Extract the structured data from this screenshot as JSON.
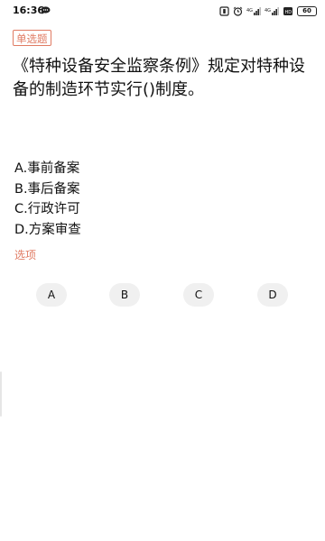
{
  "status_bar": {
    "time": "16:36",
    "battery": "60",
    "icons": [
      "chat-icon",
      "mute-icon",
      "alarm-icon",
      "wifi-icon",
      "signal-icon",
      "signal-icon",
      "battery-icon"
    ]
  },
  "question": {
    "type_tag": "单选题",
    "text": "《特种设备安全监察条例》规定对特种设备的制造环节实行()制度。"
  },
  "options": [
    {
      "text": "A.事前备案"
    },
    {
      "text": "B.事后备案"
    },
    {
      "text": "C.行政许可"
    },
    {
      "text": "D.方案审查"
    }
  ],
  "options_label": "选项",
  "answers": [
    {
      "label": "A"
    },
    {
      "label": "B"
    },
    {
      "label": "C"
    },
    {
      "label": "D"
    }
  ],
  "colors": {
    "accent": "#e07b63",
    "answer_bg": "#f0f0f0",
    "text": "#111111"
  }
}
